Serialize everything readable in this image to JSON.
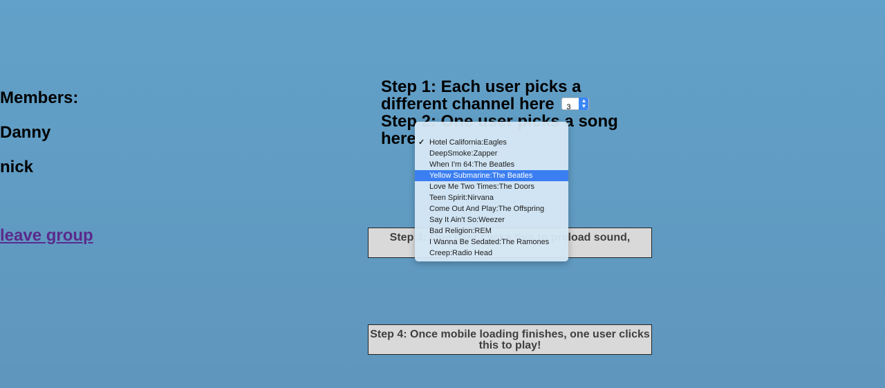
{
  "members": {
    "title": "Members:",
    "list": [
      "Danny",
      "nick"
    ]
  },
  "leave_link": "leave group",
  "steps": {
    "step1_text": "Step 1: Each user picks a different channel here",
    "channel_value": "3",
    "step2_text": "Step 2: One user picks a song here",
    "step3_label": "Step 3: One user clicks this to preload sound,",
    "step4_label": "Step 4: Once mobile loading finishes, one user clicks this to play!"
  },
  "song_dropdown": {
    "selected_index": 3,
    "checked_index": 0,
    "options": [
      "Hotel California:Eagles",
      "DeepSmoke:Zapper",
      "When I'm 64:The Beatles",
      "Yellow Submarine:The Beatles",
      "Love Me Two Times:The Doors",
      "Teen Spirit:Nirvana",
      "Come Out And Play:The Offspring",
      "Say It Ain't So:Weezer",
      "Bad Religion:REM",
      "I Wanna Be Sedated:The Ramones",
      "Creep:Radio Head"
    ]
  },
  "colors": {
    "background": "#62a1c9",
    "link": "#5a2a8c",
    "selection": "#3b7ef1"
  }
}
